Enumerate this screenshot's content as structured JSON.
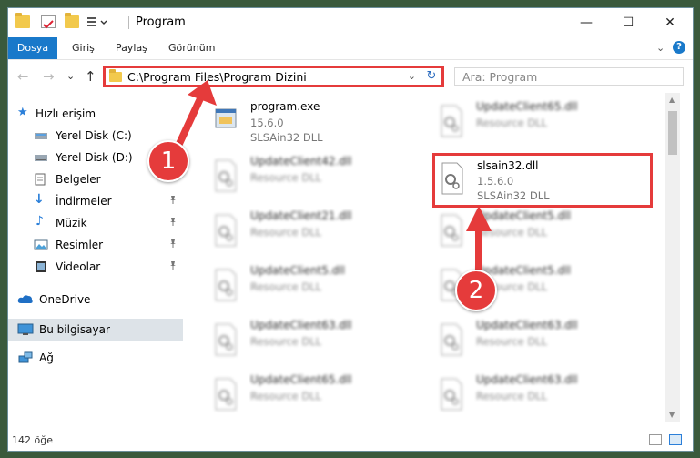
{
  "window": {
    "title": "Program",
    "controls": {
      "minimize": "—",
      "maximize": "☐",
      "close": "✕"
    }
  },
  "ribbon": {
    "tabs": [
      {
        "label": "Dosya",
        "active": true
      },
      {
        "label": "Giriş"
      },
      {
        "label": "Paylaş"
      },
      {
        "label": "Görünüm"
      }
    ],
    "expand": "⌄",
    "help": "?"
  },
  "nav": {
    "back": "←",
    "forward": "→",
    "recent": "⌄",
    "up": "↑"
  },
  "address": {
    "path": "C:\\Program Files\\Program Dizini",
    "chevron": "⌄",
    "refresh": "↻",
    "highlight_color": "#e53b3b"
  },
  "search": {
    "placeholder": "Ara: Program",
    "icon": "search-icon"
  },
  "sidebar": {
    "items": [
      {
        "label": "Hızlı erişim",
        "icon": "star-icon"
      },
      {
        "label": "Yerel Disk (C:)",
        "icon": "drive-icon"
      },
      {
        "label": "Yerel Disk (D:)",
        "icon": "drive-icon"
      },
      {
        "label": "Belgeler",
        "icon": "document-icon"
      },
      {
        "label": "İndirmeler",
        "icon": "download-icon",
        "pinned": true
      },
      {
        "label": "Müzik",
        "icon": "music-icon",
        "pinned": true
      },
      {
        "label": "Resimler",
        "icon": "picture-icon",
        "pinned": true
      },
      {
        "label": "Videolar",
        "icon": "video-icon",
        "pinned": true
      },
      {
        "label": "OneDrive",
        "icon": "cloud-icon"
      },
      {
        "label": "Bu bilgisayar",
        "icon": "computer-icon",
        "selected": true
      },
      {
        "label": "Ağ",
        "icon": "network-icon"
      }
    ],
    "pin_glyph": "📌"
  },
  "files": {
    "left": [
      {
        "name": "program.exe",
        "line2": "15.6.0",
        "line3": "SLSAin32 DLL"
      },
      {
        "name": "UpdateClient42.dll",
        "line2": "Resource DLL"
      },
      {
        "name": "UpdateClient21.dll",
        "line2": "Resource DLL"
      },
      {
        "name": "UpdateClient5.dll",
        "line2": "Resource DLL"
      },
      {
        "name": "UpdateClient63.dll",
        "line2": "Resource DLL"
      },
      {
        "name": "UpdateClient65.dll",
        "line2": "Resource DLL"
      }
    ],
    "right": [
      {
        "name": "UpdateClient65.dll",
        "line2": "Resource DLL"
      },
      {
        "name": "slsain32.dll",
        "line2": "1.5.6.0",
        "line3": "SLSAin32 DLL",
        "highlighted": true
      },
      {
        "name": "UpdateClient5.dll",
        "line2": "Resource DLL"
      },
      {
        "name": "UpdateClient5.dll",
        "line2": "Resource DLL"
      },
      {
        "name": "UpdateClient63.dll",
        "line2": "Resource DLL"
      },
      {
        "name": "UpdateClient63.dll",
        "line2": "Resource DLL"
      }
    ]
  },
  "status": {
    "count": "142 öğe"
  },
  "annotations": {
    "badge1": "1",
    "badge2": "2",
    "color": "#e53b3b"
  }
}
